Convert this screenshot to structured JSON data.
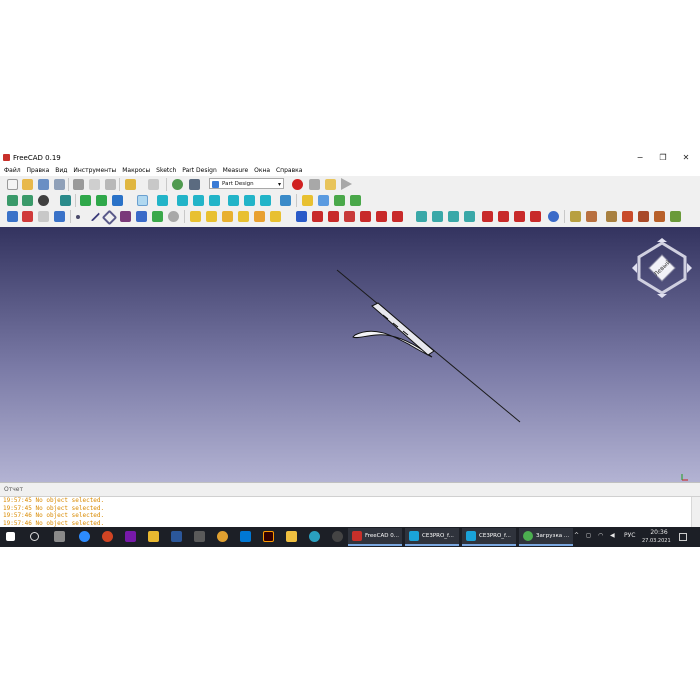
{
  "window": {
    "title": "FreeCAD 0.19",
    "minimize": "−",
    "maximize": "❐",
    "close": "✕"
  },
  "menu": [
    "Файл",
    "Правка",
    "Вид",
    "Инструменты",
    "Макросы",
    "Sketch",
    "Part Design",
    "Measure",
    "Окна",
    "Справка"
  ],
  "workbench_selector": {
    "value": "Part Design"
  },
  "report_view": {
    "title": "Отчет",
    "lines": [
      "19:57:45  No object selected.",
      "19:57:45  No object selected.",
      "19:57:46  No object selected.",
      "19:57:46  No object selected."
    ],
    "text_color": "#d98a00"
  },
  "navigation_cube": {
    "face_label": "Левый"
  },
  "taskbar": {
    "apps": [
      {
        "label": "FreeCAD 0...",
        "color": "#c8302a"
      },
      {
        "label": "CE3PRO_f...",
        "color": "#1aa3d9"
      },
      {
        "label": "CE3PRO_f...",
        "color": "#1aa3d9"
      },
      {
        "label": "Загрузка ...",
        "color": "#4caf50"
      }
    ],
    "language": "РУС",
    "time": "20:36",
    "date": "27.03.2021"
  },
  "colors": {
    "viewport_top": "#33335f",
    "viewport_bottom": "#b3b3d3",
    "accent_red": "#d02020"
  }
}
